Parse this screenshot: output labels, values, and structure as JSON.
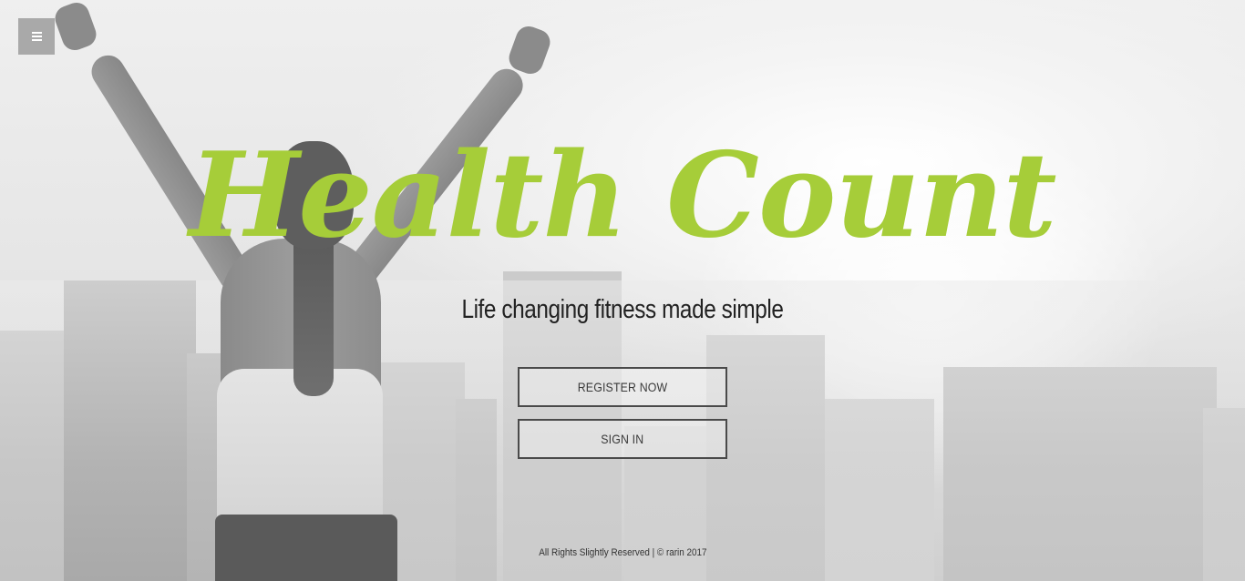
{
  "menu": {
    "icon": "hamburger-menu-icon"
  },
  "hero": {
    "title": "Health Count",
    "tagline": "Life changing fitness made simple"
  },
  "actions": {
    "register_label": "REGISTER NOW",
    "signin_label": "SIGN IN"
  },
  "footer": {
    "text": "All Rights Slightly Reserved | © rarin 2017"
  },
  "colors": {
    "title_green": "#a6cd39",
    "menu_bg": "#a9a9a9",
    "button_border": "#4a4a4a",
    "tagline_text": "#222222"
  }
}
